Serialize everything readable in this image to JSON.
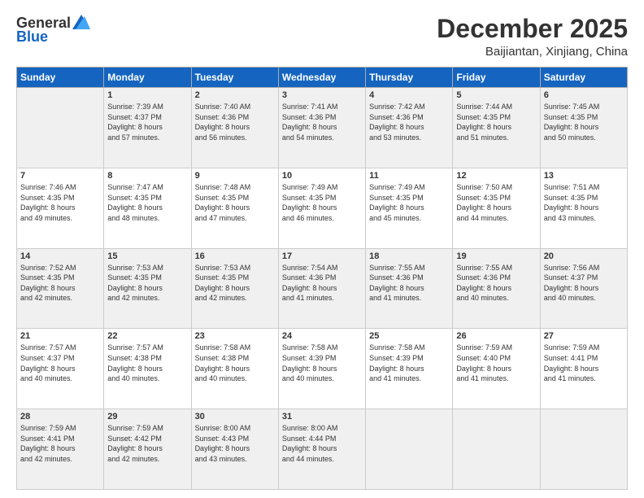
{
  "logo": {
    "general": "General",
    "blue": "Blue"
  },
  "title": "December 2025",
  "subtitle": "Baijiantan, Xinjiang, China",
  "days_of_week": [
    "Sunday",
    "Monday",
    "Tuesday",
    "Wednesday",
    "Thursday",
    "Friday",
    "Saturday"
  ],
  "weeks": [
    [
      {
        "day": "",
        "info": ""
      },
      {
        "day": "1",
        "info": "Sunrise: 7:39 AM\nSunset: 4:37 PM\nDaylight: 8 hours\nand 57 minutes."
      },
      {
        "day": "2",
        "info": "Sunrise: 7:40 AM\nSunset: 4:36 PM\nDaylight: 8 hours\nand 56 minutes."
      },
      {
        "day": "3",
        "info": "Sunrise: 7:41 AM\nSunset: 4:36 PM\nDaylight: 8 hours\nand 54 minutes."
      },
      {
        "day": "4",
        "info": "Sunrise: 7:42 AM\nSunset: 4:36 PM\nDaylight: 8 hours\nand 53 minutes."
      },
      {
        "day": "5",
        "info": "Sunrise: 7:44 AM\nSunset: 4:35 PM\nDaylight: 8 hours\nand 51 minutes."
      },
      {
        "day": "6",
        "info": "Sunrise: 7:45 AM\nSunset: 4:35 PM\nDaylight: 8 hours\nand 50 minutes."
      }
    ],
    [
      {
        "day": "7",
        "info": "Sunrise: 7:46 AM\nSunset: 4:35 PM\nDaylight: 8 hours\nand 49 minutes."
      },
      {
        "day": "8",
        "info": "Sunrise: 7:47 AM\nSunset: 4:35 PM\nDaylight: 8 hours\nand 48 minutes."
      },
      {
        "day": "9",
        "info": "Sunrise: 7:48 AM\nSunset: 4:35 PM\nDaylight: 8 hours\nand 47 minutes."
      },
      {
        "day": "10",
        "info": "Sunrise: 7:49 AM\nSunset: 4:35 PM\nDaylight: 8 hours\nand 46 minutes."
      },
      {
        "day": "11",
        "info": "Sunrise: 7:49 AM\nSunset: 4:35 PM\nDaylight: 8 hours\nand 45 minutes."
      },
      {
        "day": "12",
        "info": "Sunrise: 7:50 AM\nSunset: 4:35 PM\nDaylight: 8 hours\nand 44 minutes."
      },
      {
        "day": "13",
        "info": "Sunrise: 7:51 AM\nSunset: 4:35 PM\nDaylight: 8 hours\nand 43 minutes."
      }
    ],
    [
      {
        "day": "14",
        "info": "Sunrise: 7:52 AM\nSunset: 4:35 PM\nDaylight: 8 hours\nand 42 minutes."
      },
      {
        "day": "15",
        "info": "Sunrise: 7:53 AM\nSunset: 4:35 PM\nDaylight: 8 hours\nand 42 minutes."
      },
      {
        "day": "16",
        "info": "Sunrise: 7:53 AM\nSunset: 4:35 PM\nDaylight: 8 hours\nand 42 minutes."
      },
      {
        "day": "17",
        "info": "Sunrise: 7:54 AM\nSunset: 4:36 PM\nDaylight: 8 hours\nand 41 minutes."
      },
      {
        "day": "18",
        "info": "Sunrise: 7:55 AM\nSunset: 4:36 PM\nDaylight: 8 hours\nand 41 minutes."
      },
      {
        "day": "19",
        "info": "Sunrise: 7:55 AM\nSunset: 4:36 PM\nDaylight: 8 hours\nand 40 minutes."
      },
      {
        "day": "20",
        "info": "Sunrise: 7:56 AM\nSunset: 4:37 PM\nDaylight: 8 hours\nand 40 minutes."
      }
    ],
    [
      {
        "day": "21",
        "info": "Sunrise: 7:57 AM\nSunset: 4:37 PM\nDaylight: 8 hours\nand 40 minutes."
      },
      {
        "day": "22",
        "info": "Sunrise: 7:57 AM\nSunset: 4:38 PM\nDaylight: 8 hours\nand 40 minutes."
      },
      {
        "day": "23",
        "info": "Sunrise: 7:58 AM\nSunset: 4:38 PM\nDaylight: 8 hours\nand 40 minutes."
      },
      {
        "day": "24",
        "info": "Sunrise: 7:58 AM\nSunset: 4:39 PM\nDaylight: 8 hours\nand 40 minutes."
      },
      {
        "day": "25",
        "info": "Sunrise: 7:58 AM\nSunset: 4:39 PM\nDaylight: 8 hours\nand 41 minutes."
      },
      {
        "day": "26",
        "info": "Sunrise: 7:59 AM\nSunset: 4:40 PM\nDaylight: 8 hours\nand 41 minutes."
      },
      {
        "day": "27",
        "info": "Sunrise: 7:59 AM\nSunset: 4:41 PM\nDaylight: 8 hours\nand 41 minutes."
      }
    ],
    [
      {
        "day": "28",
        "info": "Sunrise: 7:59 AM\nSunset: 4:41 PM\nDaylight: 8 hours\nand 42 minutes."
      },
      {
        "day": "29",
        "info": "Sunrise: 7:59 AM\nSunset: 4:42 PM\nDaylight: 8 hours\nand 42 minutes."
      },
      {
        "day": "30",
        "info": "Sunrise: 8:00 AM\nSunset: 4:43 PM\nDaylight: 8 hours\nand 43 minutes."
      },
      {
        "day": "31",
        "info": "Sunrise: 8:00 AM\nSunset: 4:44 PM\nDaylight: 8 hours\nand 44 minutes."
      },
      {
        "day": "",
        "info": ""
      },
      {
        "day": "",
        "info": ""
      },
      {
        "day": "",
        "info": ""
      }
    ]
  ]
}
